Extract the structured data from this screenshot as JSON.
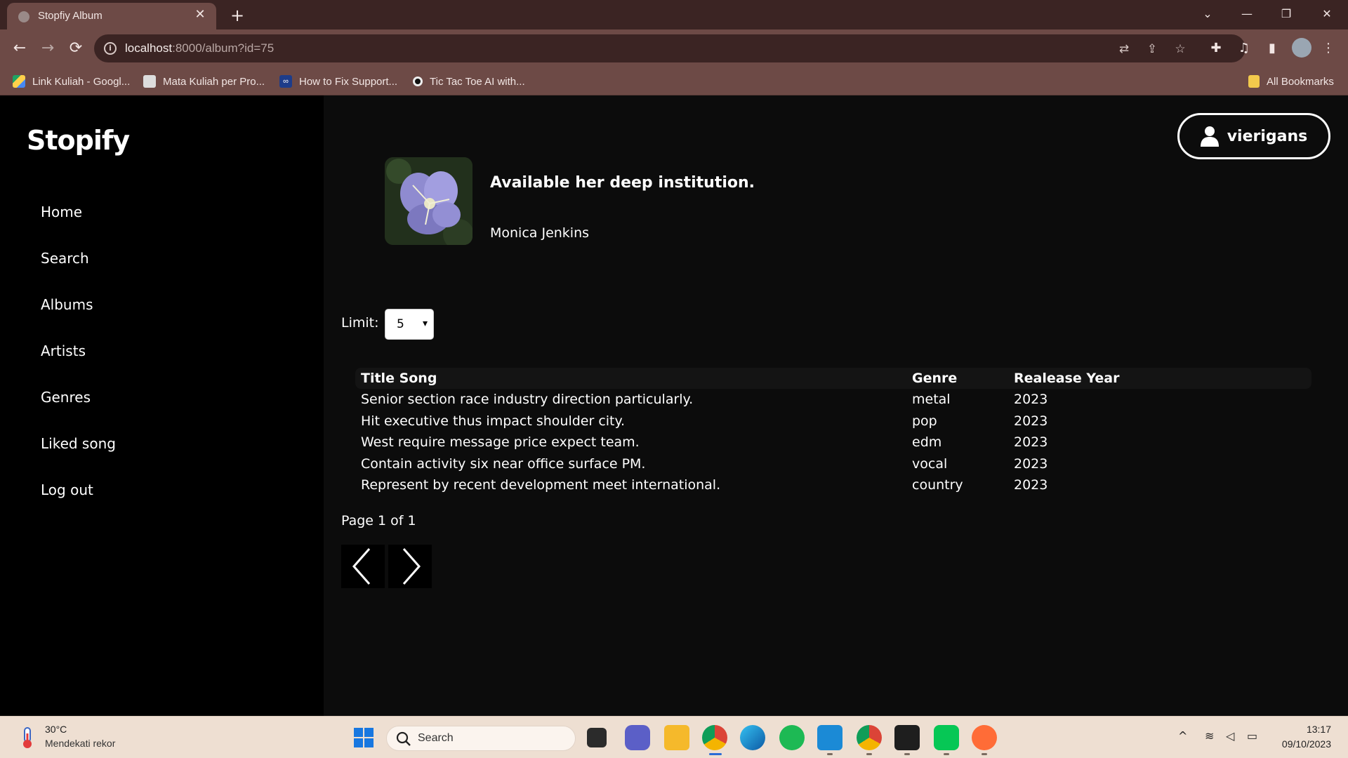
{
  "browser": {
    "tab_title": "Stopfiy Album",
    "tab_close": "✕",
    "new_tab": "+",
    "url_host": "localhost",
    "url_rest": ":8000/album?id=75",
    "bookmarks": [
      {
        "label": "Link Kuliah - Googl...",
        "icon": "google-drive-icon"
      },
      {
        "label": "Mata Kuliah per Pro...",
        "icon": "pixel-icon"
      },
      {
        "label": "How to Fix Support...",
        "icon": "infinity-icon"
      },
      {
        "label": "Tic Tac Toe AI with...",
        "icon": "circle-icon"
      }
    ],
    "all_bookmarks": "All Bookmarks"
  },
  "app": {
    "logo": "Stopify",
    "nav": [
      "Home",
      "Search",
      "Albums",
      "Artists",
      "Genres",
      "Liked song",
      "Log out"
    ],
    "user_name": "vierigans"
  },
  "album": {
    "title": "Available her deep institution.",
    "artist": "Monica Jenkins"
  },
  "limit": {
    "label": "Limit:",
    "value": "5"
  },
  "songs": {
    "headers": {
      "title": "Title Song",
      "genre": "Genre",
      "year": "Realease Year"
    },
    "rows": [
      {
        "title": "Senior section race industry direction particularly.",
        "genre": "metal",
        "year": "2023"
      },
      {
        "title": "Hit executive thus impact shoulder city.",
        "genre": "pop",
        "year": "2023"
      },
      {
        "title": "West require message price expect team.",
        "genre": "edm",
        "year": "2023"
      },
      {
        "title": "Contain activity six near office surface PM.",
        "genre": "vocal",
        "year": "2023"
      },
      {
        "title": "Represent by recent development meet international.",
        "genre": "country",
        "year": "2023"
      }
    ]
  },
  "pagination": {
    "info": "Page 1 of 1"
  },
  "taskbar": {
    "temp": "30°C",
    "weather_desc": "Mendekati rekor",
    "search_label": "Search",
    "time": "13:17",
    "date": "09/10/2023"
  },
  "colors": {
    "sidebar_bg": "#000000",
    "main_bg": "#0c0c0c",
    "chrome_tab": "#6d4a46",
    "chrome_frame": "#3b2423",
    "taskbar_bg": "#eedfd2"
  }
}
